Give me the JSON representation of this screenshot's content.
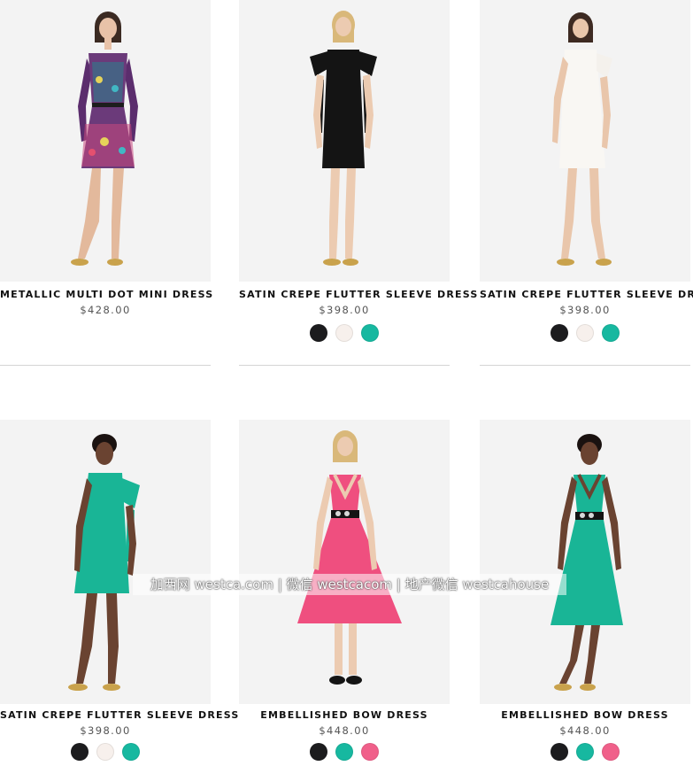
{
  "products": [
    {
      "name": "METALLIC MULTI DOT MINI DRESS",
      "price": "$428.00",
      "swatches": []
    },
    {
      "name": "SATIN CREPE FLUTTER SLEEVE DRESS",
      "price": "$398.00",
      "swatches": [
        "#1c1c1e",
        "#f7f0ec",
        "#17b8a0"
      ]
    },
    {
      "name": "SATIN CREPE FLUTTER SLEEVE DRESS",
      "price": "$398.00",
      "swatches": [
        "#1c1c1e",
        "#f7f0ec",
        "#17b8a0"
      ]
    },
    {
      "name": "SATIN CREPE FLUTTER SLEEVE DRESS",
      "price": "$398.00",
      "swatches": [
        "#1c1c1e",
        "#f7f0ec",
        "#17b8a0"
      ]
    },
    {
      "name": "EMBELLISHED BOW DRESS",
      "price": "$448.00",
      "swatches": [
        "#1c1c1e",
        "#17b8a0",
        "#f0608a"
      ]
    },
    {
      "name": "EMBELLISHED BOW DRESS",
      "price": "$448.00",
      "swatches": [
        "#1c1c1e",
        "#17b8a0",
        "#f0608a"
      ]
    }
  ],
  "watermark": "加西网 westca.com | 微信 westcacom | 地产微信 westcahouse",
  "colors": {
    "photo_background": "#f3f3f3",
    "divider": "#d5d5d5",
    "price_text": "#555555"
  }
}
